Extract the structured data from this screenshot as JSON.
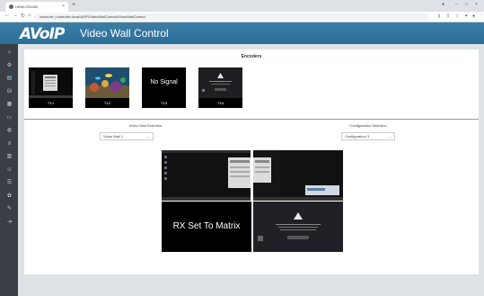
{
  "browser": {
    "tab_title": "HDIN-VS1000",
    "tab_close": "×",
    "new_tab": "+",
    "url": "Insecure | controller.local/AVIP/VideoWallControl/VideoWallControl",
    "win_min": "–",
    "win_max": "□",
    "win_close": "×"
  },
  "app": {
    "logo": "AVoIP",
    "title": "Video Wall Control"
  },
  "sidebar": {
    "items": [
      {
        "name": "home",
        "glyph": "⌂"
      },
      {
        "name": "settings",
        "glyph": "⚙"
      },
      {
        "name": "video-wall",
        "glyph": "▤"
      },
      {
        "name": "database",
        "glyph": "⛁"
      },
      {
        "name": "matrix",
        "glyph": "▦"
      },
      {
        "name": "monitor",
        "glyph": "▭"
      },
      {
        "name": "globe",
        "glyph": "◍"
      },
      {
        "name": "list",
        "glyph": "≡"
      },
      {
        "name": "layers",
        "glyph": "▥"
      },
      {
        "name": "user",
        "glyph": "☺"
      },
      {
        "name": "menu",
        "glyph": "☰"
      },
      {
        "name": "gear",
        "glyph": "✿"
      },
      {
        "name": "tools",
        "glyph": "✎"
      },
      {
        "name": "logout",
        "glyph": "⇥"
      }
    ]
  },
  "encoders": {
    "title": "Encoders",
    "items": [
      {
        "label": "TX1",
        "kind": "desktop"
      },
      {
        "label": "TX2",
        "kind": "aquarium"
      },
      {
        "label": "TX3",
        "kind": "no-signal",
        "text": "No Signal"
      },
      {
        "label": "TX4",
        "kind": "warning"
      }
    ]
  },
  "video_wall_selection": {
    "label": "Video Wall Selection",
    "value": "Video Wall 1"
  },
  "configuration_selection": {
    "label": "Configuration Selection",
    "value": "Configuration 3"
  },
  "wall": {
    "rx_text": "RX Set To Matrix"
  }
}
